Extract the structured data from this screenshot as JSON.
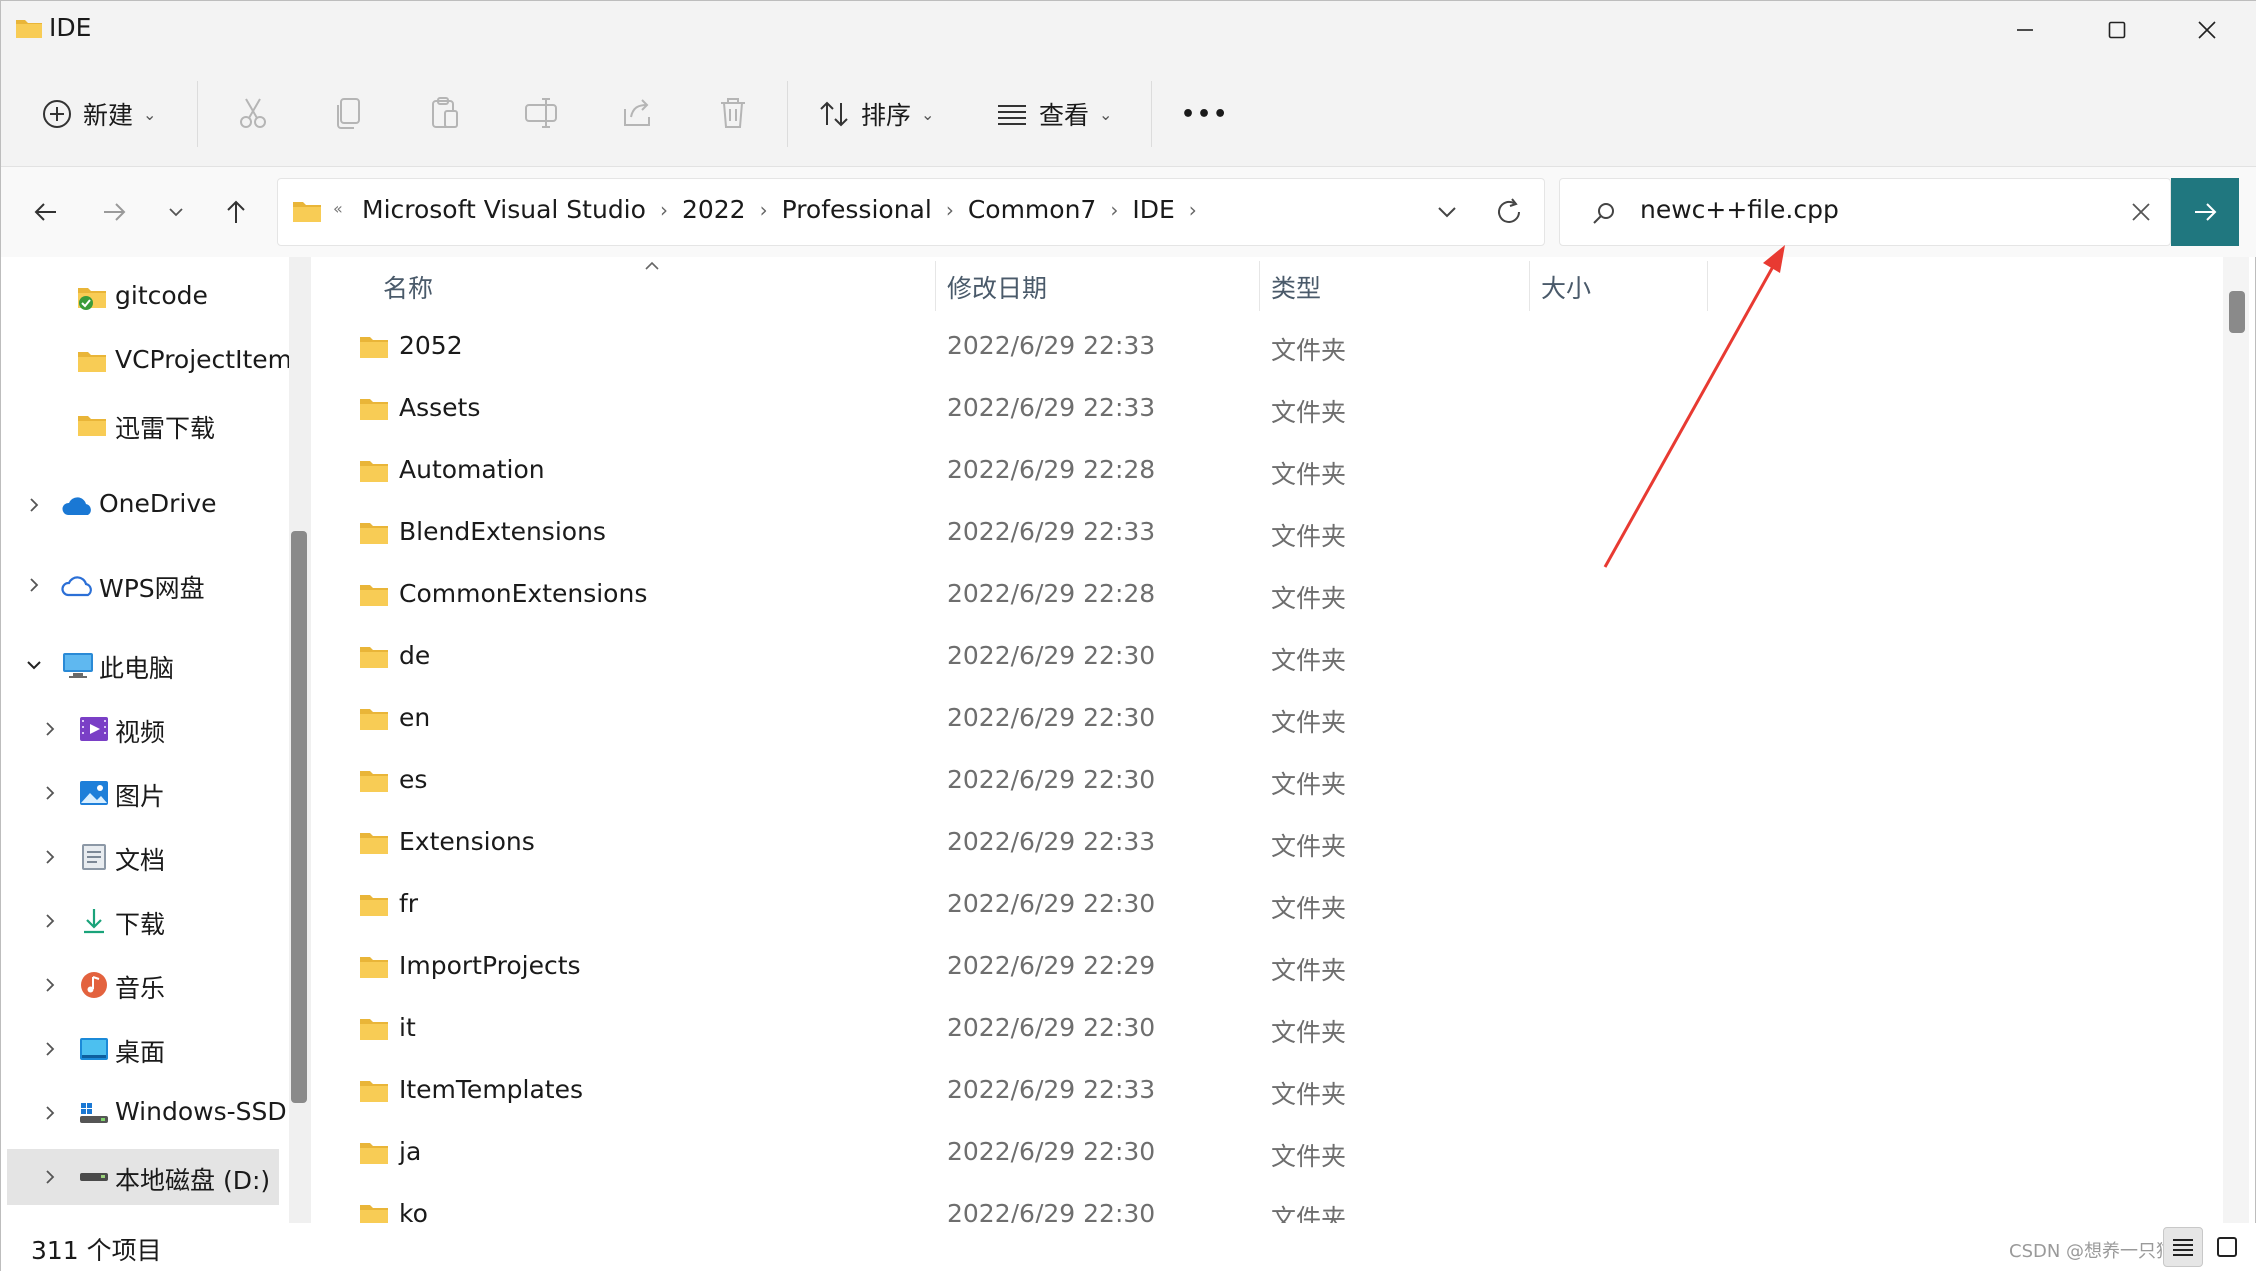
{
  "window": {
    "title": "IDE",
    "minimize_icon": "minimize-icon",
    "maximize_icon": "maximize-icon",
    "close_icon": "close-icon"
  },
  "toolbar": {
    "new_label": "新建",
    "sort_label": "排序",
    "view_label": "查看",
    "more_label": "•••",
    "icons": [
      "new-icon",
      "cut-icon",
      "copy-icon",
      "paste-icon",
      "rename-icon",
      "share-icon",
      "delete-icon",
      "sort-icon",
      "view-icon",
      "more-icon"
    ]
  },
  "address": {
    "collapse_marker": "«",
    "breadcrumbs": [
      "Microsoft Visual Studio",
      "2022",
      "Professional",
      "Common7",
      "IDE"
    ]
  },
  "search": {
    "value": "newc++file.cpp"
  },
  "sidebar": {
    "items": [
      {
        "label": "gitcode",
        "icon": "folder-synced-icon"
      },
      {
        "label": "VCProjectItem",
        "icon": "folder-icon"
      },
      {
        "label": "迅雷下载",
        "icon": "folder-icon"
      },
      {
        "label": "OneDrive",
        "icon": "onedrive-cloud-icon"
      },
      {
        "label": "WPS网盘",
        "icon": "wps-cloud-icon"
      },
      {
        "label": "此电脑",
        "icon": "this-pc-icon"
      },
      {
        "label": "视频",
        "icon": "videos-icon"
      },
      {
        "label": "图片",
        "icon": "pictures-icon"
      },
      {
        "label": "文档",
        "icon": "documents-icon"
      },
      {
        "label": "下载",
        "icon": "downloads-icon"
      },
      {
        "label": "音乐",
        "icon": "music-icon"
      },
      {
        "label": "桌面",
        "icon": "desktop-icon"
      },
      {
        "label": "Windows-SSD",
        "icon": "drive-c-icon"
      },
      {
        "label": "本地磁盘 (D:)",
        "icon": "drive-d-icon"
      }
    ]
  },
  "columns": {
    "name": "名称",
    "date": "修改日期",
    "type": "类型",
    "size": "大小"
  },
  "files": [
    {
      "name": "2052",
      "date": "2022/6/29 22:33",
      "type": "文件夹"
    },
    {
      "name": "Assets",
      "date": "2022/6/29 22:33",
      "type": "文件夹"
    },
    {
      "name": "Automation",
      "date": "2022/6/29 22:28",
      "type": "文件夹"
    },
    {
      "name": "BlendExtensions",
      "date": "2022/6/29 22:33",
      "type": "文件夹"
    },
    {
      "name": "CommonExtensions",
      "date": "2022/6/29 22:28",
      "type": "文件夹"
    },
    {
      "name": "de",
      "date": "2022/6/29 22:30",
      "type": "文件夹"
    },
    {
      "name": "en",
      "date": "2022/6/29 22:30",
      "type": "文件夹"
    },
    {
      "name": "es",
      "date": "2022/6/29 22:30",
      "type": "文件夹"
    },
    {
      "name": "Extensions",
      "date": "2022/6/29 22:33",
      "type": "文件夹"
    },
    {
      "name": "fr",
      "date": "2022/6/29 22:30",
      "type": "文件夹"
    },
    {
      "name": "ImportProjects",
      "date": "2022/6/29 22:29",
      "type": "文件夹"
    },
    {
      "name": "it",
      "date": "2022/6/29 22:30",
      "type": "文件夹"
    },
    {
      "name": "ItemTemplates",
      "date": "2022/6/29 22:33",
      "type": "文件夹"
    },
    {
      "name": "ja",
      "date": "2022/6/29 22:30",
      "type": "文件夹"
    },
    {
      "name": "ko",
      "date": "2022/6/29 22:30",
      "type": "文件夹"
    }
  ],
  "status": {
    "item_count": "311 个项目",
    "watermark": "CSDN @想养一只猫"
  },
  "colors": {
    "accent": "#20777f",
    "folder": "#f4c34a",
    "annotation_arrow": "#e83a32"
  }
}
